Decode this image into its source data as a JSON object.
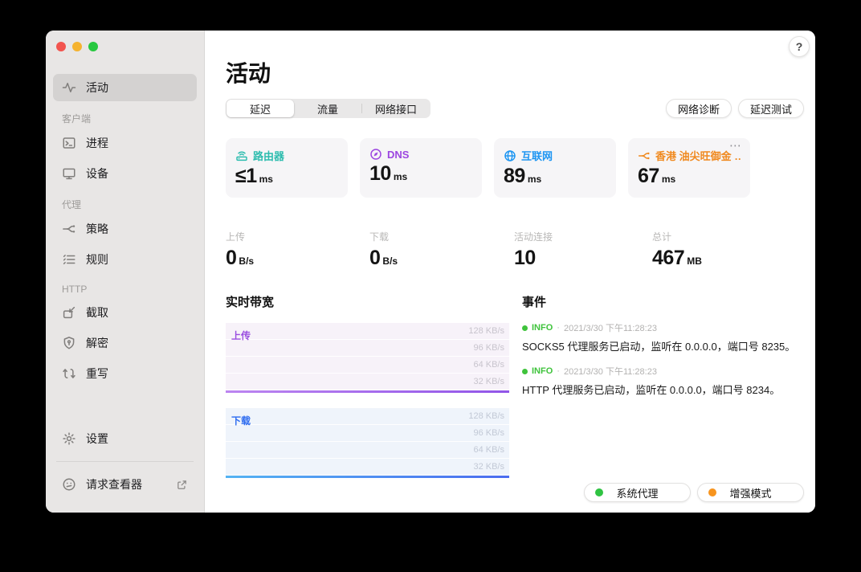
{
  "window_controls": {
    "close_color": "#f2544e",
    "minimize_color": "#f5b32f",
    "zoom_color": "#27c83f"
  },
  "help_button": {
    "label": "?"
  },
  "sidebar": {
    "groups": [
      {
        "title": "",
        "items": [
          {
            "label": "活动",
            "icon": "activity-icon",
            "selected": true
          }
        ]
      },
      {
        "title": "客户端",
        "items": [
          {
            "label": "进程",
            "icon": "terminal-icon"
          },
          {
            "label": "设备",
            "icon": "monitor-icon"
          }
        ]
      },
      {
        "title": "代理",
        "items": [
          {
            "label": "策略",
            "icon": "policy-icon"
          },
          {
            "label": "规则",
            "icon": "rules-icon"
          }
        ]
      },
      {
        "title": "HTTP",
        "items": [
          {
            "label": "截取",
            "icon": "capture-icon"
          },
          {
            "label": "解密",
            "icon": "shield-key-icon"
          },
          {
            "label": "重写",
            "icon": "rewrite-icon"
          }
        ]
      }
    ],
    "settings": {
      "label": "设置",
      "icon": "gear-icon"
    },
    "request_viewer": {
      "label": "请求查看器",
      "icon": "face-icon",
      "external_icon": "external-link-icon"
    }
  },
  "header": {
    "title": "活动",
    "tabs": [
      {
        "label": "延迟",
        "active": true
      },
      {
        "label": "流量",
        "active": false
      },
      {
        "label": "网络接口",
        "active": false
      }
    ],
    "actions": [
      {
        "label": "网络诊断"
      },
      {
        "label": "延迟测试"
      }
    ]
  },
  "latency_cards": [
    {
      "label": "路由器",
      "value": "≤1",
      "unit": "ms",
      "color": "#2cbcae",
      "icon": "router-icon"
    },
    {
      "label": "DNS",
      "value": "10",
      "unit": "ms",
      "color": "#9c46e0",
      "icon": "compass-icon"
    },
    {
      "label": "互联网",
      "value": "89",
      "unit": "ms",
      "color": "#1e96f2",
      "icon": "globe-icon"
    },
    {
      "label": "香港 油尖旺御金 …",
      "value": "67",
      "unit": "ms",
      "color": "#f0891e",
      "icon": "policy-icon",
      "more_label": "⋯"
    }
  ],
  "stats": [
    {
      "label": "上传",
      "value": "0",
      "unit": "B/s"
    },
    {
      "label": "下载",
      "value": "0",
      "unit": "B/s"
    },
    {
      "label": "活动连接",
      "value": "10",
      "unit": ""
    },
    {
      "label": "总计",
      "value": "467",
      "unit": "MB"
    }
  ],
  "bandwidth": {
    "title": "实时带宽",
    "charts": [
      {
        "label": "上传",
        "label_color": "#9b4fe0",
        "ticks": [
          "128 KB/s",
          "96 KB/s",
          "64 KB/s",
          "32 KB/s"
        ]
      },
      {
        "label": "下载",
        "label_color": "#2e6cf0",
        "ticks": [
          "128 KB/s",
          "96 KB/s",
          "64 KB/s",
          "32 KB/s"
        ]
      }
    ]
  },
  "chart_data": [
    {
      "type": "area",
      "title": "上传",
      "ylabel": "KB/s",
      "ytick_values": [
        128,
        96,
        64,
        32
      ],
      "ylim": [
        0,
        137
      ],
      "values": [
        0,
        0,
        0,
        0,
        0,
        0,
        0,
        0,
        0,
        0,
        0,
        0
      ],
      "line_color": "#9155e8",
      "grid": true
    },
    {
      "type": "area",
      "title": "下载",
      "ylabel": "KB/s",
      "ytick_values": [
        128,
        96,
        64,
        32
      ],
      "ylim": [
        0,
        137
      ],
      "values": [
        0,
        0,
        0,
        1,
        0,
        0,
        0,
        0,
        1,
        0,
        0,
        0
      ],
      "line_color": "#4b6cf0",
      "grid": true
    }
  ],
  "events": {
    "title": "事件",
    "separator": "·",
    "level_color": "#3fc33c",
    "items": [
      {
        "level": "INFO",
        "time": "2021/3/30 下午11:28:23",
        "message": "SOCKS5 代理服务已启动，监听在 0.0.0.0，端口号 8235。"
      },
      {
        "level": "INFO",
        "time": "2021/3/30 下午11:28:23",
        "message": "HTTP 代理服务已启动，监听在 0.0.0.0，端口号 8234。"
      }
    ]
  },
  "status_buttons": [
    {
      "label": "系统代理",
      "dot_color": "#2fc342"
    },
    {
      "label": "增强模式",
      "dot_color": "#f7941e"
    }
  ]
}
